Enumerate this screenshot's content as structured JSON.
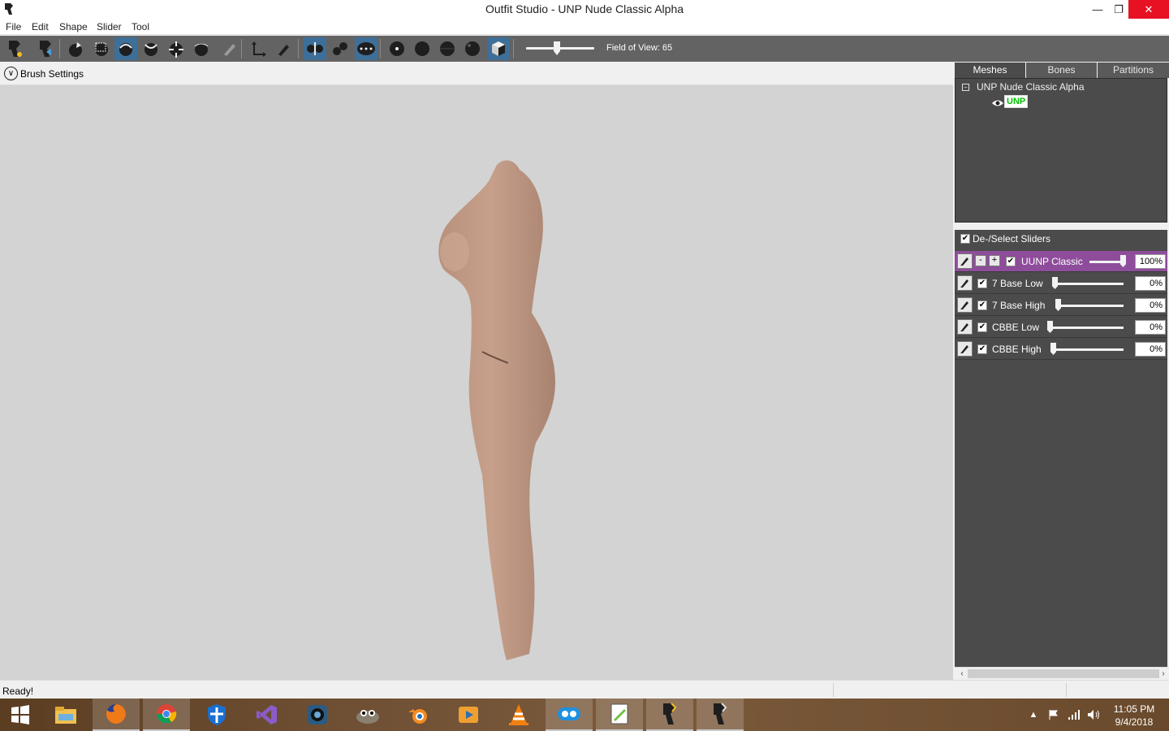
{
  "window": {
    "title": "Outfit Studio - UNP Nude Classic Alpha",
    "minimize_glyph": "—",
    "maximize_glyph": "❐",
    "close_glyph": "✕"
  },
  "menu": {
    "file": "File",
    "edit": "Edit",
    "shape": "Shape",
    "slider": "Slider",
    "tool": "Tool"
  },
  "toolbar": {
    "fov_label": "Field of View: 65",
    "fov_value": 65
  },
  "brush_settings": {
    "label": "Brush Settings",
    "toggle_glyph": "∨"
  },
  "panel": {
    "tabs": {
      "meshes": "Meshes",
      "bones": "Bones",
      "partitions": "Partitions"
    },
    "tree": {
      "expander_glyph": "−",
      "root": "UNP Nude Classic Alpha",
      "child": "UNP"
    },
    "deselect_label": "De-/Select Sliders",
    "sliders": [
      {
        "name": "UUNP Classic",
        "value": "100%",
        "level": 1.0,
        "selected": true
      },
      {
        "name": "7 Base Low",
        "value": "0%",
        "level": 0.0,
        "selected": false
      },
      {
        "name": "7 Base High",
        "value": "0%",
        "level": 0.0,
        "selected": false
      },
      {
        "name": "CBBE Low",
        "value": "0%",
        "level": 0.0,
        "selected": false
      },
      {
        "name": "CBBE High",
        "value": "0%",
        "level": 0.0,
        "selected": false
      }
    ],
    "scroll_left_glyph": "‹",
    "scroll_right_glyph": "›"
  },
  "status": {
    "text": "Ready!"
  },
  "taskbar": {
    "clock_time": "11:05 PM",
    "clock_date": "9/4/2018"
  },
  "colors": {
    "toolbar_bg": "#636363",
    "panel_bg": "#4b4b4b",
    "selected_slider": "#8e4d9a",
    "active_tool": "#3d6f99",
    "viewport_bg": "#d3d3d3",
    "mesh_tag_text": "#00c000",
    "skin_tone": "#c19a85"
  }
}
